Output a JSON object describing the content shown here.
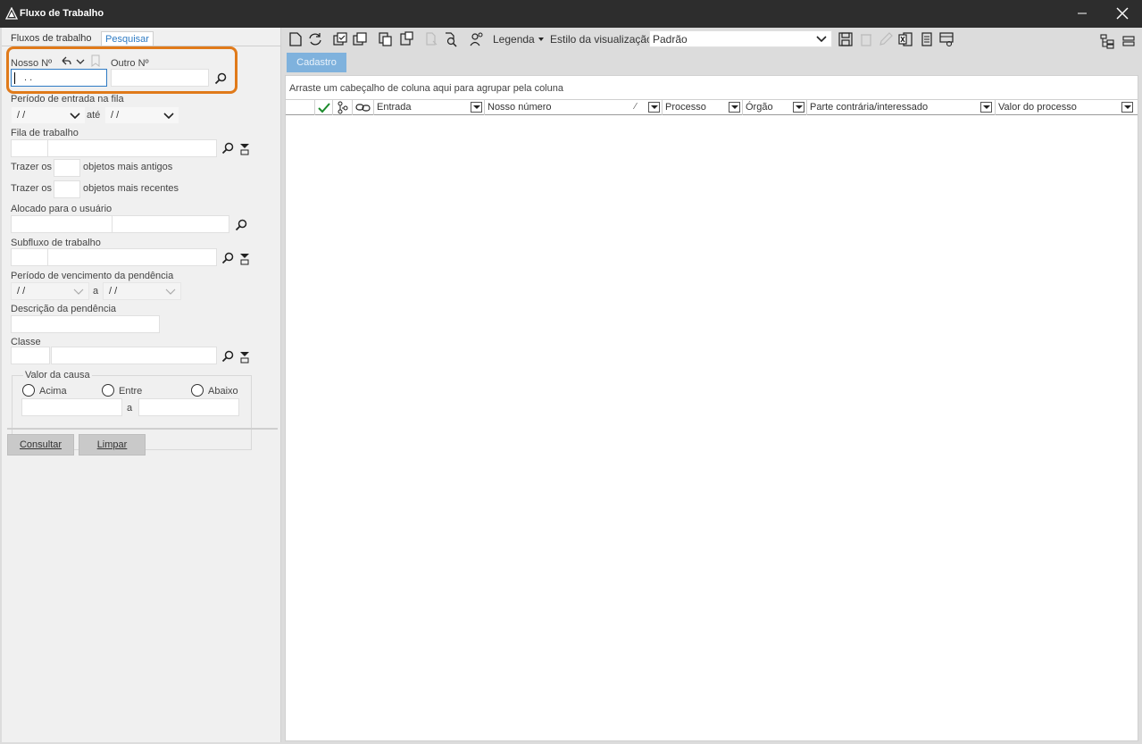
{
  "window": {
    "title": "Fluxo de Trabalho"
  },
  "tabs": {
    "flows": "Fluxos de trabalho",
    "search": "Pesquisar"
  },
  "form": {
    "nosso_label": "Nosso Nº",
    "outro_label": "Outro Nº",
    "nosso_value": ". .",
    "periodo_entrada_label": "Período de entrada na fila",
    "date_from_value": "/ /",
    "ate_label": "até",
    "date_to_value": "/ /",
    "fila_label": "Fila de trabalho",
    "trazer1_prefix": "Trazer os",
    "trazer1_suffix": "objetos mais antigos",
    "trazer2_prefix": "Trazer os",
    "trazer2_suffix": "objetos mais recentes",
    "alocado_label": "Alocado para o usuário",
    "subfluxo_label": "Subfluxo de trabalho",
    "vencimento_label": "Período de vencimento da pendência",
    "venc_from_value": "/ /",
    "venc_a_label": "a",
    "venc_to_value": "/ /",
    "descricao_label": "Descrição da pendência",
    "classe_label": "Classe",
    "valor_causa_label": "Valor da causa",
    "acima_label": "Acima",
    "entre_label": "Entre",
    "abaixo_label": "Abaixo",
    "valor_a_label": "a"
  },
  "buttons": {
    "consultar": "Consultar",
    "limpar": "Limpar"
  },
  "toolbar": {
    "legenda": "Legenda",
    "estilo_label": "Estilo da visualização",
    "estilo_value": "Padrão"
  },
  "subtab": "Cadastro",
  "grid": {
    "group_hint": "Arraste um cabeçalho de coluna aqui para agrupar pela coluna",
    "columns": [
      "Entrada",
      "Nosso número",
      "Processo",
      "Órgão",
      "Parte contrária/interessado",
      "Valor do processo"
    ]
  },
  "colors": {
    "accent": "#2e7bc4",
    "highlight": "#e07a1a",
    "titlebar": "#2d2d2d"
  }
}
